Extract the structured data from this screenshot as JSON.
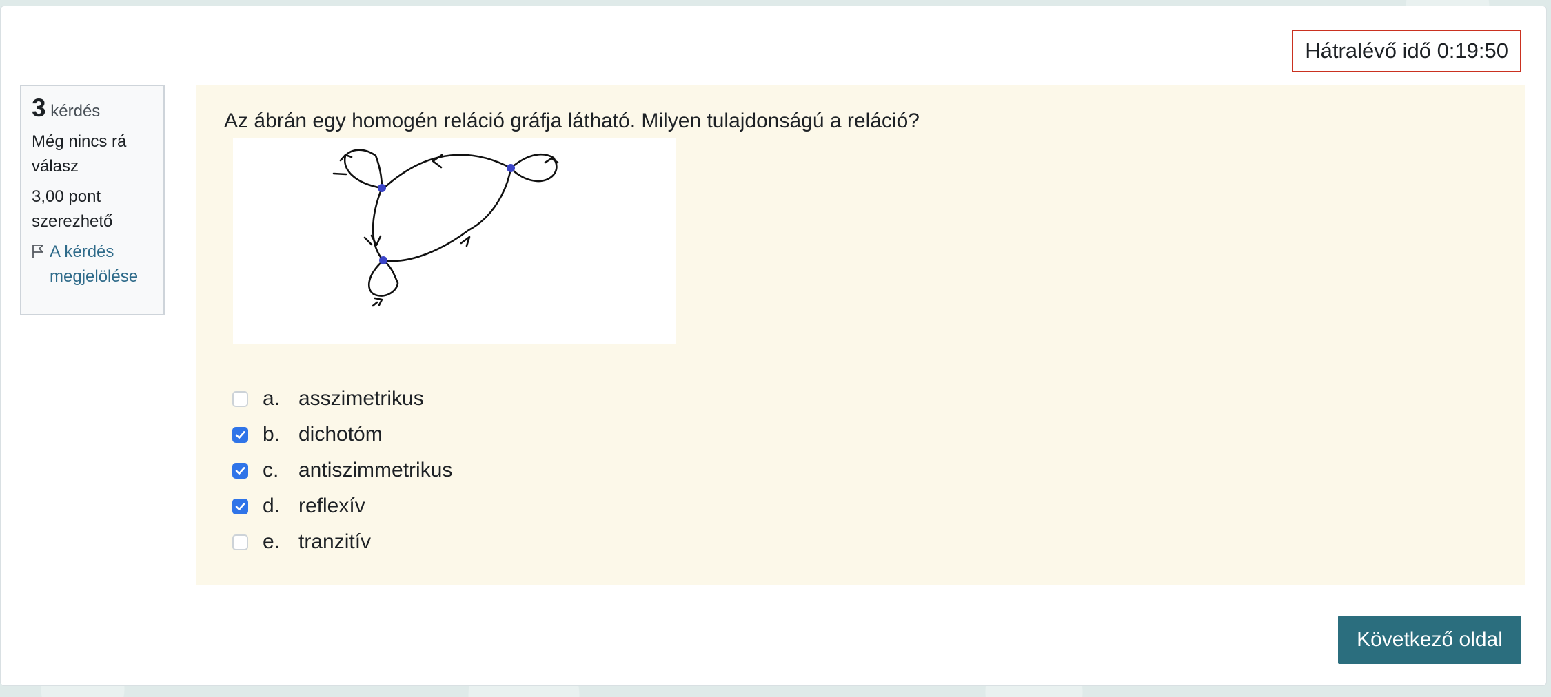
{
  "timer": {
    "label": "Hátralévő idő 0:19:50"
  },
  "question_info": {
    "number": "3",
    "number_word": "kérdés",
    "status": "Még nincs rá válasz",
    "points": "3,00 pont szerezhető",
    "flag_label": "A kérdés megjelölése"
  },
  "question": {
    "text": "Az ábrán egy homogén reláció gráfja látható. Milyen tulajdonságú a reláció?"
  },
  "answers": [
    {
      "letter": "a.",
      "label": "asszimetrikus",
      "checked": false
    },
    {
      "letter": "b.",
      "label": "dichotóm",
      "checked": true
    },
    {
      "letter": "c.",
      "label": "antiszimmetrikus",
      "checked": true
    },
    {
      "letter": "d.",
      "label": "reflexív",
      "checked": true
    },
    {
      "letter": "e.",
      "label": "tranzitív",
      "checked": false
    }
  ],
  "next_button": {
    "label": "Következő oldal"
  },
  "colors": {
    "accent": "#2b6e7e",
    "checkbox": "#2f74e8",
    "timer_border": "#ca3120",
    "question_bg": "#fcf8e9",
    "graph_node": "#3b44c8"
  },
  "icons": {
    "flag": "flag-icon",
    "checkmark": "checkmark-icon"
  }
}
